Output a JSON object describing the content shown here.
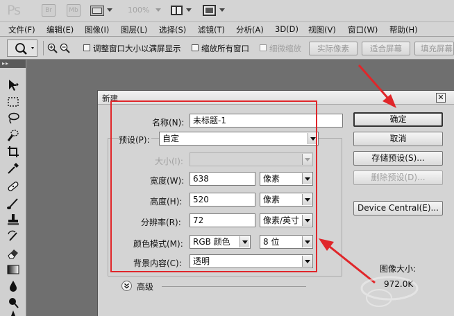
{
  "appbar": {
    "logo": "Ps",
    "bridge_label": "Br",
    "minibridge_label": "Mb",
    "zoom": "100%"
  },
  "menu": [
    "文件(F)",
    "编辑(E)",
    "图像(I)",
    "图层(L)",
    "选择(S)",
    "滤镜(T)",
    "分析(A)",
    "3D(D)",
    "视图(V)",
    "窗口(W)",
    "帮助(H)"
  ],
  "options": {
    "resize_windows": "调整窗口大小以满屏显示",
    "zoom_all": "缩放所有窗口",
    "scrubby_zoom": "细微缩放",
    "actual_pixels": "实际像素",
    "fit_screen": "适合屏幕",
    "fill_screen": "填充屏幕"
  },
  "dialog": {
    "title": "新建",
    "name_label": "名称(N):",
    "name_value": "未标题-1",
    "preset_label": "预设(P):",
    "preset_value": "自定",
    "size_label": "大小(I):",
    "size_value": "",
    "width_label": "宽度(W):",
    "width_value": "638",
    "width_unit": "像素",
    "height_label": "高度(H):",
    "height_value": "520",
    "height_unit": "像素",
    "resolution_label": "分辨率(R):",
    "resolution_value": "72",
    "resolution_unit": "像素/英寸",
    "color_mode_label": "颜色模式(M):",
    "color_mode_value": "RGB 颜色",
    "bit_depth_value": "8 位",
    "background_label": "背景内容(C):",
    "background_value": "透明",
    "advanced_label": "高级",
    "image_size_label": "图像大小:",
    "image_size_value": "972.0K",
    "buttons": {
      "ok": "确定",
      "cancel": "取消",
      "save_preset": "存储预设(S)...",
      "delete_preset": "删除预设(D)...",
      "device_central": "Device Central(E)..."
    }
  },
  "colors": {
    "annotation": "#e0262a"
  }
}
